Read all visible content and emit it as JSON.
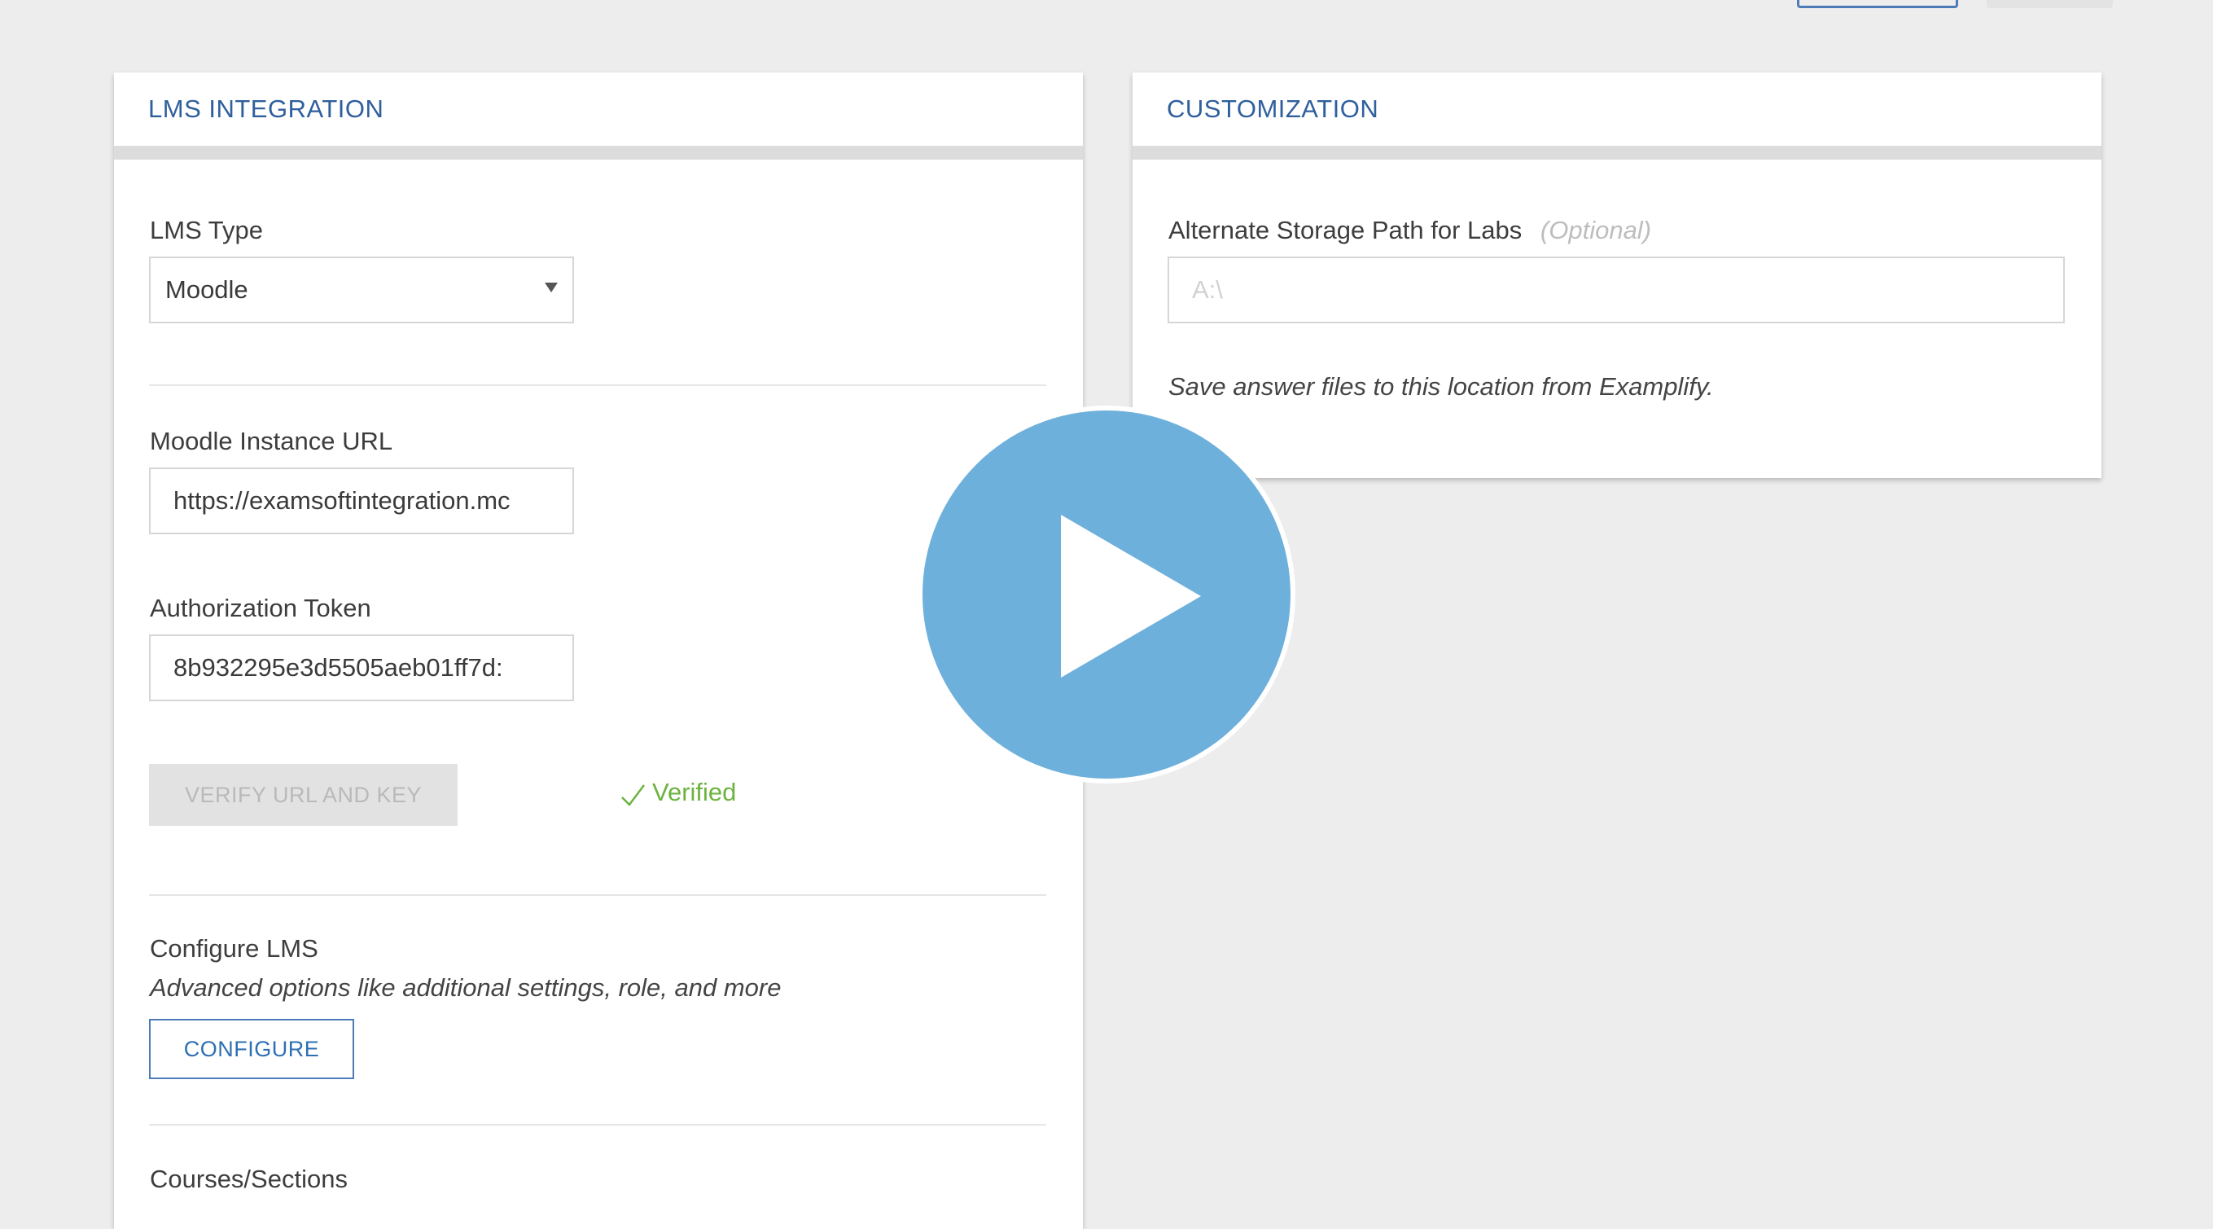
{
  "lms_integration": {
    "title": "LMS INTEGRATION",
    "lms_type_label": "LMS Type",
    "lms_type_value": "Moodle",
    "instance_url_label": "Moodle Instance URL",
    "instance_url_value": "https://examsoftintegration.mc",
    "auth_token_label": "Authorization Token",
    "auth_token_value": "8b932295e3d5505aeb01ff7d:",
    "verify_button_label": "VERIFY URL AND KEY",
    "verified_label": "Verified",
    "configure_heading": "Configure LMS",
    "configure_description": "Advanced options like additional settings, role, and more",
    "configure_button_label": "CONFIGURE",
    "courses_heading": "Courses/Sections"
  },
  "customization": {
    "title": "CUSTOMIZATION",
    "storage_path_label": "Alternate Storage Path for Labs",
    "storage_path_optional": "(Optional)",
    "storage_path_placeholder": "A:\\",
    "storage_path_help": "Save answer files to this location from Examplify."
  },
  "icons": {
    "dropdown": "chevron-down-icon",
    "verified": "check-icon",
    "play": "play-icon"
  },
  "colors": {
    "accent": "#2f5f9d",
    "verified": "#6cb33f",
    "play_button": "#6eb0dc"
  }
}
